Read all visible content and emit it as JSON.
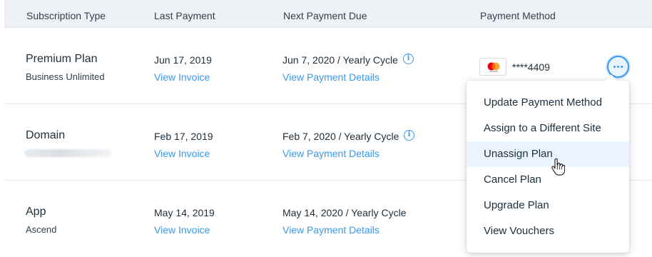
{
  "header": {
    "col_type": "Subscription Type",
    "col_last": "Last Payment",
    "col_next": "Next Payment Due",
    "col_method": "Payment Method"
  },
  "rows": [
    {
      "title": "Premium Plan",
      "subtitle": "Business Unlimited",
      "last_date": "Jun 17, 2019",
      "view_invoice": "View Invoice",
      "next_due": "Jun 7, 2020 / Yearly Cycle",
      "view_details": "View Payment Details",
      "card_number": "****4409"
    },
    {
      "title": "Domain",
      "subtitle": "",
      "last_date": "Feb 17, 2019",
      "view_invoice": "View Invoice",
      "next_due": "Feb 7, 2020 / Yearly Cycle",
      "view_details": "View Payment Details"
    },
    {
      "title": "App",
      "subtitle": "Ascend",
      "last_date": "May 14, 2019",
      "view_invoice": "View Invoice",
      "next_due": "May 14, 2020 / Yearly Cycle",
      "view_details": "View Payment Details"
    }
  ],
  "menu": {
    "items": [
      "Update Payment Method",
      "Assign to a Different Site",
      "Unassign Plan",
      "Cancel Plan",
      "Upgrade Plan",
      "View Vouchers"
    ],
    "hovered": "Unassign Plan"
  },
  "icons": {
    "info": "info-icon",
    "card": "mastercard-icon",
    "more": "more-horizontal-icon",
    "cursor": "hand-pointer-icon"
  },
  "colors": {
    "accent": "#3899ec",
    "text": "#20303c",
    "header_bg": "#eef1f5",
    "hover_bg": "#eaf4fe"
  }
}
